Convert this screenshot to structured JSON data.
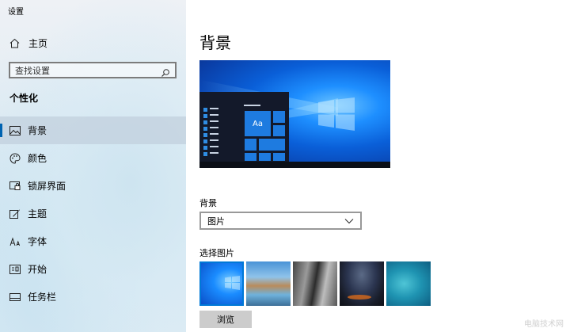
{
  "window": {
    "title": "设置"
  },
  "sidebar": {
    "home_label": "主页",
    "search_placeholder": "查找设置",
    "section_title": "个性化",
    "items": [
      {
        "label": "背景",
        "icon": "image-icon",
        "active": true
      },
      {
        "label": "颜色",
        "icon": "palette-icon",
        "active": false
      },
      {
        "label": "锁屏界面",
        "icon": "lock-screen-icon",
        "active": false
      },
      {
        "label": "主题",
        "icon": "theme-icon",
        "active": false
      },
      {
        "label": "字体",
        "icon": "font-icon",
        "active": false
      },
      {
        "label": "开始",
        "icon": "start-icon",
        "active": false
      },
      {
        "label": "任务栏",
        "icon": "taskbar-icon",
        "active": false
      }
    ]
  },
  "main": {
    "title": "背景",
    "preview_tile_text": "Aa",
    "background_label": "背景",
    "background_select_value": "图片",
    "choose_picture_label": "选择图片",
    "browse_button": "浏览"
  },
  "watermark": "电脑技术网",
  "colors": {
    "accent": "#0078d7",
    "active_indicator": "#0063b1"
  }
}
